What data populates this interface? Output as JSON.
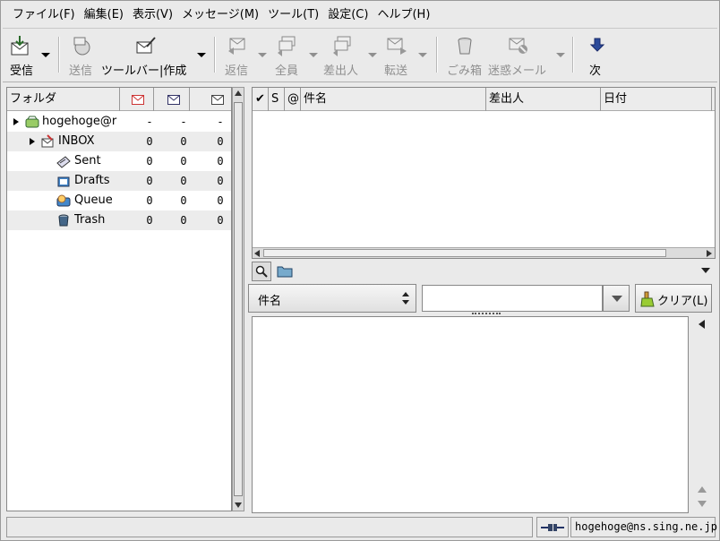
{
  "menubar": {
    "items": [
      {
        "label": "ファイル(F)"
      },
      {
        "label": "編集(E)"
      },
      {
        "label": "表示(V)"
      },
      {
        "label": "メッセージ(M)"
      },
      {
        "label": "ツール(T)"
      },
      {
        "label": "設定(C)"
      },
      {
        "label": "ヘルプ(H)"
      }
    ]
  },
  "toolbar": {
    "receive": "受信",
    "send": "送信",
    "compose": "ツールバー|作成",
    "reply": "返信",
    "reply_all": "全員",
    "reply_sender": "差出人",
    "forward": "転送",
    "trash": "ごみ箱",
    "spam": "迷惑メール",
    "next": "次"
  },
  "folder_pane": {
    "header": {
      "folder": "フォルダ"
    },
    "rows": [
      {
        "name": "hogehoge@r",
        "unread": "-",
        "new": "-",
        "total": "-"
      },
      {
        "name": "INBOX",
        "unread": "0",
        "new": "0",
        "total": "0"
      },
      {
        "name": "Sent",
        "unread": "0",
        "new": "0",
        "total": "0"
      },
      {
        "name": "Drafts",
        "unread": "0",
        "new": "0",
        "total": "0"
      },
      {
        "name": "Queue",
        "unread": "0",
        "new": "0",
        "total": "0"
      },
      {
        "name": "Trash",
        "unread": "0",
        "new": "0",
        "total": "0"
      }
    ]
  },
  "message_list": {
    "columns": {
      "mark": "✔",
      "status": "S",
      "attach": "@",
      "subject": "件名",
      "from": "差出人",
      "date": "日付"
    }
  },
  "quick_search": {
    "field": "件名",
    "value": "",
    "clear": "クリア(L)"
  },
  "status": {
    "message": "",
    "account": "hogehoge@ns.sing.ne.jp"
  }
}
